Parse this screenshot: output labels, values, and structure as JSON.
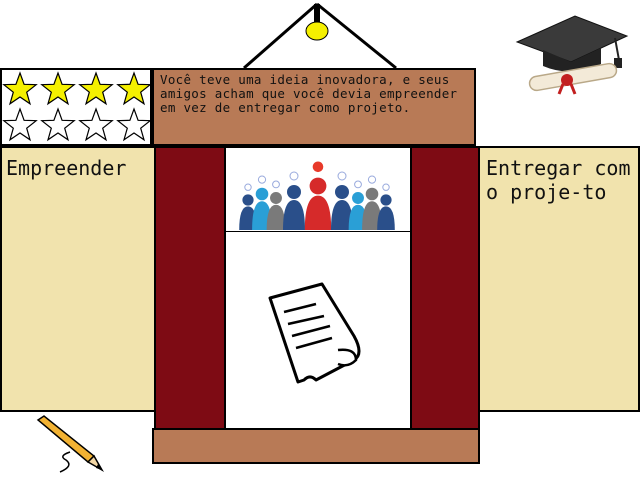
{
  "stars": {
    "filled": 4,
    "empty": 4,
    "filled_color": "#f5f000",
    "empty_color": "#ffffff"
  },
  "prompt": {
    "text": "Você teve uma ideia inovadora, e seus amigos acham que você devia empreender em vez de entregar como projeto."
  },
  "options": {
    "left_label": "Empreender",
    "right_label": "Entregar como proje-to"
  },
  "colors": {
    "curtain": "#7e0b14",
    "wood": "#b87a56",
    "card": "#f1e3ad",
    "lamp": "#f5f000"
  },
  "icons": [
    "lamp-icon",
    "graduation-cap-icon",
    "diploma-icon",
    "team-ideas-icon",
    "document-icon",
    "pencil-icon"
  ]
}
